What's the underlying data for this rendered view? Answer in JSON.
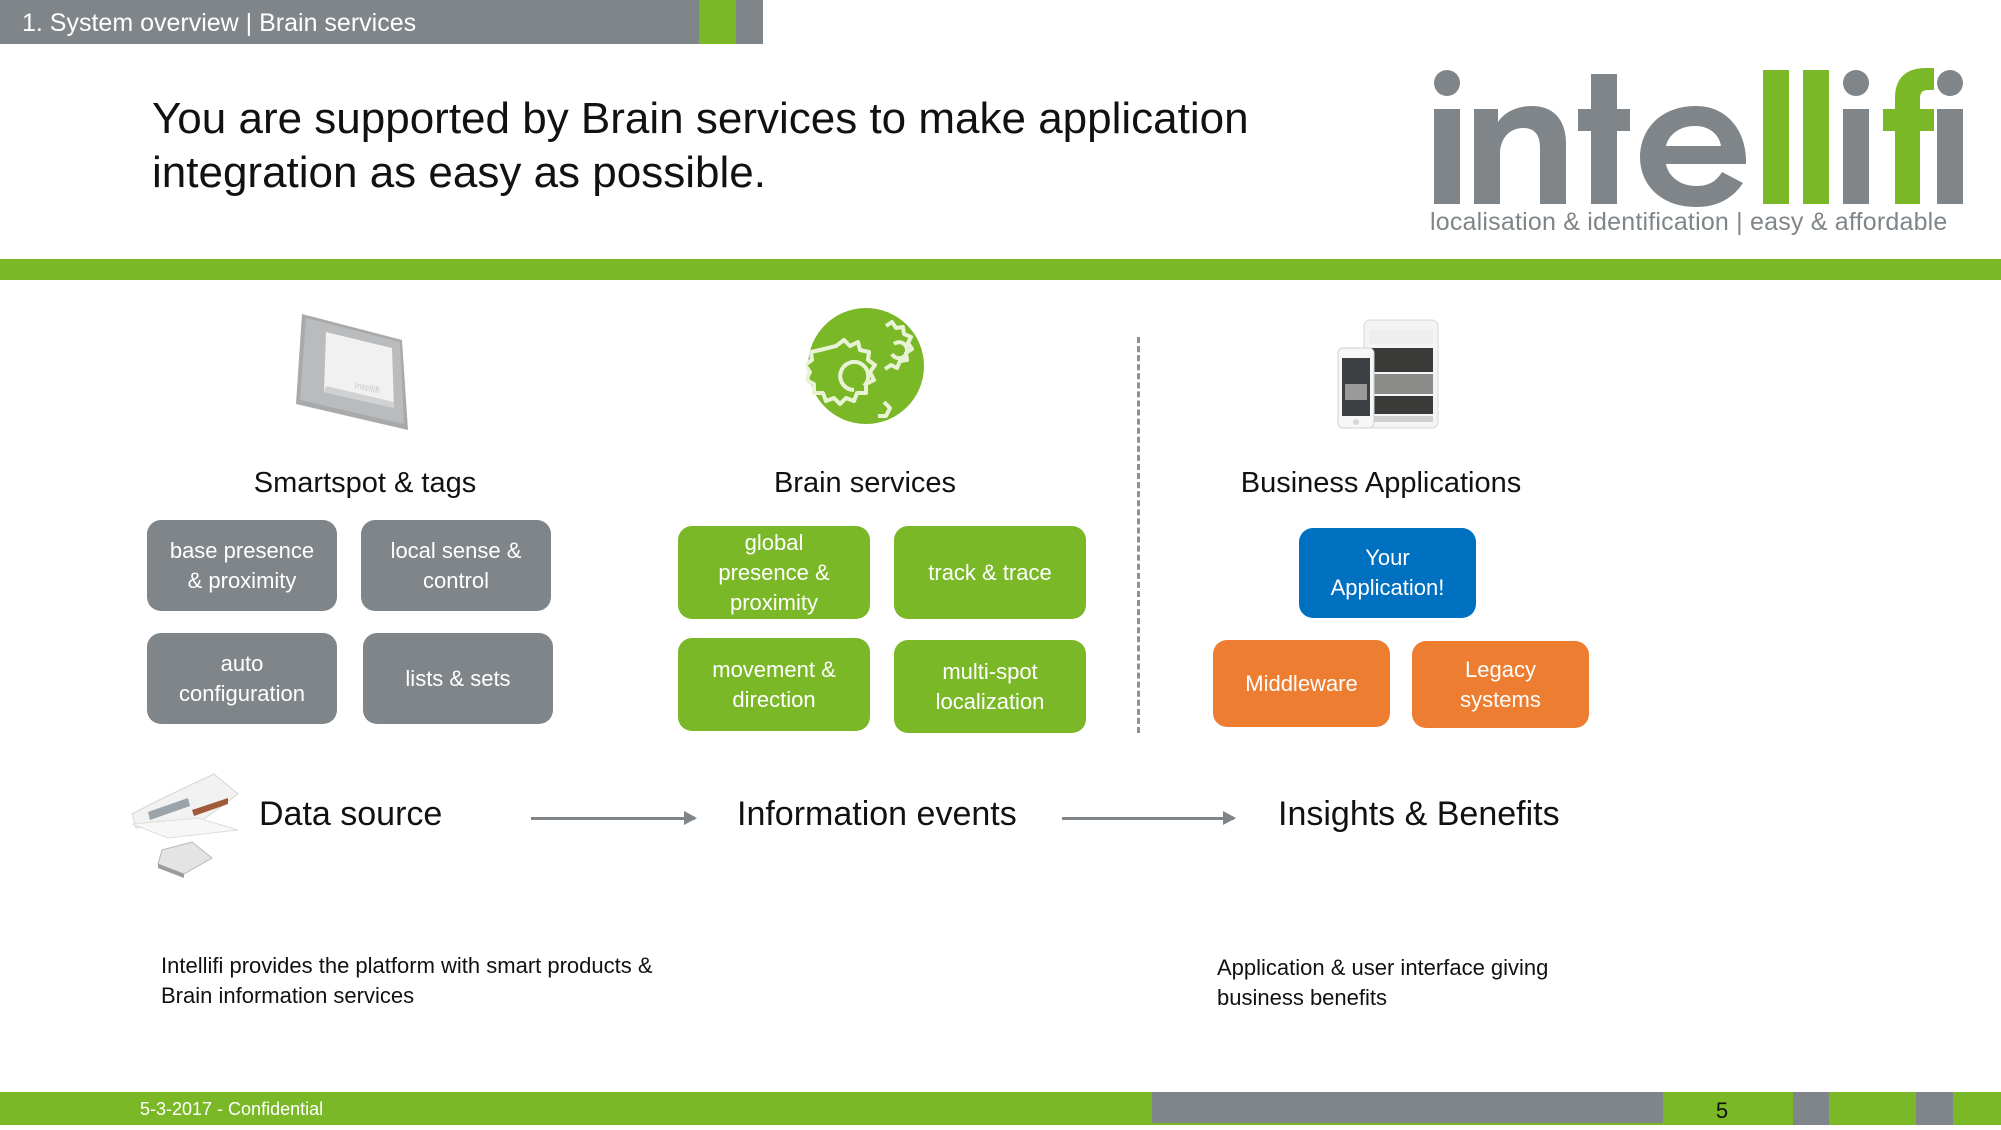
{
  "header": {
    "section_label": "1. System overview | Brain services"
  },
  "title": {
    "line1": "You are supported by Brain services to make application",
    "line2": "integration as easy as possible."
  },
  "logo": {
    "parts": [
      {
        "text": "inte",
        "color": "#7f8588"
      },
      {
        "text": "ll",
        "color": "#7ab827"
      },
      {
        "text": "i",
        "color": "#7f8588"
      },
      {
        "text": "f",
        "color": "#7ab827"
      },
      {
        "text": "i",
        "color": "#7f8588"
      }
    ],
    "tagline": "localisation & identification  |  easy & affordable"
  },
  "colors": {
    "brand_green": "#7ab827",
    "brand_gray": "#7f8588",
    "app_blue": "#0070c0",
    "integration_orange": "#ed7d31"
  },
  "columns": [
    {
      "heading": "Smartspot & tags",
      "icon": "smartspot-device-icon",
      "boxes": [
        {
          "l1": "base presence",
          "l2": "& proximity"
        },
        {
          "l1": "local sense &",
          "l2": "control"
        },
        {
          "l1": "auto",
          "l2": "configuration"
        },
        {
          "l1": "lists & sets",
          "l2": ""
        }
      ]
    },
    {
      "heading": "Brain services",
      "icon": "gears-icon",
      "boxes": [
        {
          "l1": "global",
          "l2": "presence &",
          "l3": "proximity"
        },
        {
          "l1": "track & trace"
        },
        {
          "l1": "movement &",
          "l2": "direction"
        },
        {
          "l1": "multi-spot",
          "l2": "localization"
        }
      ]
    },
    {
      "heading": "Business Applications",
      "icon": "tablet-phone-icon",
      "boxes": [
        {
          "l1": "Your",
          "l2": "Application!"
        },
        {
          "l1": "Middleware"
        },
        {
          "l1": "Legacy",
          "l2": "systems"
        }
      ]
    }
  ],
  "flow": {
    "steps": [
      "Data source",
      "Information events",
      "Insights & Benefits"
    ]
  },
  "descriptions": {
    "left": {
      "l1": "Intellifi provides the platform with smart products &",
      "l2": "Brain information services"
    },
    "right": {
      "l1": "Application & user interface giving",
      "l2": "business benefits"
    }
  },
  "footer": {
    "date_label": "5-3-2017 - Confidential",
    "page_number": "5"
  }
}
